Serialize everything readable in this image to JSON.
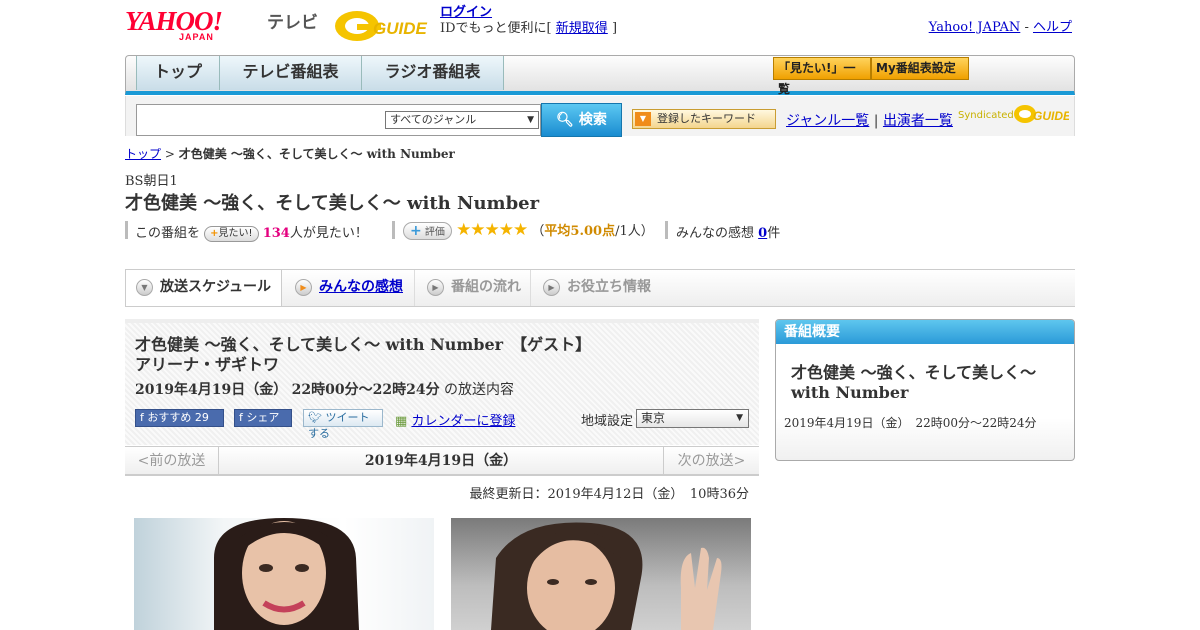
{
  "header": {
    "yahoo_logo": "YAHOO!",
    "yahoo_japan": "JAPAN",
    "service": "テレビ",
    "gguide_logo": "G-GUIDE",
    "login": "ログイン",
    "login_sub_prefix": "IDでもっと便利に[",
    "register": "新規取得",
    "login_sub_suffix": "]",
    "yahoo_japan_link": "Yahoo! JAPAN",
    "sep": "-",
    "help": "ヘルプ"
  },
  "nav": {
    "tabs": [
      "トップ",
      "テレビ番組表",
      "ラジオ番組表"
    ],
    "mitai_list": "「見たい!」一覧",
    "my_schedule": "My番組表設定"
  },
  "search": {
    "placeholder": "",
    "genre": "すべてのジャンル",
    "button": "検索",
    "keyword": "登録したキーワード",
    "genre_list": "ジャンル一覧",
    "divider": "|",
    "cast_list": "出演者一覧",
    "syndicated": "Syndicated"
  },
  "breadcrumb": {
    "top": "トップ",
    "sep": ">",
    "current": "才色健美 ～強く、そして美しく～ with Number"
  },
  "program": {
    "channel": "BS朝日1",
    "title": "才色健美 ～強く、そして美しく～ with Number",
    "mitai_prefix": "この番組を",
    "mitai_btn": "見たい!",
    "mitai_count": "134",
    "mitai_suffix": "人が見たい！",
    "rating_btn": "評価",
    "stars": "★★★★★",
    "avg_open": "（",
    "avg": "平均5.00点",
    "avg_close": "/1人）",
    "impressions_label": "みんなの感想",
    "impressions_count": "0",
    "impressions_unit": "件"
  },
  "tabs": {
    "schedule": "放送スケジュール",
    "impressions": "みんなの感想",
    "flow": "番組の流れ",
    "info": "お役立ち情報"
  },
  "episode": {
    "title": "才色健美 ～強く、そして美しく～ with Number　【ゲスト】アリーナ・ザギトワ",
    "date": "2019年4月19日（金）",
    "time": "22時00分～22時24分",
    "date_suffix": "の放送内容",
    "fb_recommend": "おすすめ",
    "fb_count": "29",
    "fb_share": "シェア",
    "tweet": "ツイートする",
    "calendar": "カレンダーに登録",
    "region_label": "地域設定",
    "region": "東京",
    "prev": "<前の放送",
    "current_date": "2019年4月19日（金）",
    "next": "次の放送>",
    "updated": "最終更新日：2019年4月12日（金）　10時36分"
  },
  "sidebar": {
    "heading": "番組概要",
    "title": "才色健美 ～強く、そして美しく～ with Number",
    "datetime": "2019年4月19日（金）　22時00分～22時24分"
  },
  "colors": {
    "accent_blue": "#1a9ad6",
    "yahoo_red": "#ff0033",
    "orange": "#f0a000",
    "star": "#f5b400",
    "link": "#0000cc"
  }
}
